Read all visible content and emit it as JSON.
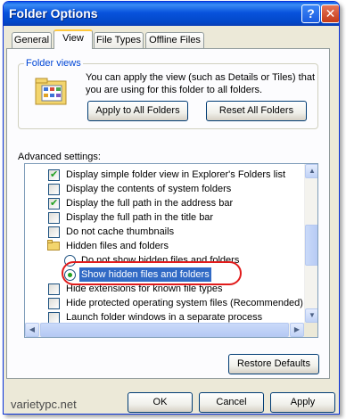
{
  "window": {
    "title": "Folder Options",
    "help_glyph": "?",
    "close_glyph": "✕"
  },
  "tabs": [
    {
      "label": "General"
    },
    {
      "label": "View"
    },
    {
      "label": "File Types"
    },
    {
      "label": "Offline Files"
    }
  ],
  "folder_views": {
    "legend": "Folder views",
    "description": "You can apply the view (such as Details or Tiles) that you are using for this folder to all folders.",
    "apply_label": "Apply to All Folders",
    "reset_label": "Reset All Folders"
  },
  "advanced": {
    "label": "Advanced settings:",
    "items": [
      {
        "type": "checkbox",
        "checked": true,
        "label": "Display simple folder view in Explorer's Folders list"
      },
      {
        "type": "checkbox",
        "checked": false,
        "label": "Display the contents of system folders"
      },
      {
        "type": "checkbox",
        "checked": true,
        "label": "Display the full path in the address bar"
      },
      {
        "type": "checkbox",
        "checked": false,
        "label": "Display the full path in the title bar"
      },
      {
        "type": "checkbox",
        "checked": false,
        "label": "Do not cache thumbnails"
      },
      {
        "type": "folder",
        "label": "Hidden files and folders"
      },
      {
        "type": "radio",
        "checked": false,
        "label": "Do not show hidden files and folders"
      },
      {
        "type": "radio",
        "checked": true,
        "label": "Show hidden files and folders",
        "selected": true
      },
      {
        "type": "checkbox",
        "checked": false,
        "label": "Hide extensions for known file types"
      },
      {
        "type": "checkbox",
        "checked": false,
        "label": "Hide protected operating system files (Recommended)"
      },
      {
        "type": "checkbox",
        "checked": false,
        "label": "Launch folder windows in a separate process"
      }
    ],
    "restore_label": "Restore Defaults"
  },
  "footer": {
    "ok_label": "OK",
    "cancel_label": "Cancel",
    "apply_label": "Apply"
  },
  "watermark": "varietypc.net",
  "colors": {
    "title_bar": "#0853dd",
    "selection": "#316ac5",
    "highlight_ring": "#e11b1b",
    "tab_accent": "#ffc83c"
  }
}
